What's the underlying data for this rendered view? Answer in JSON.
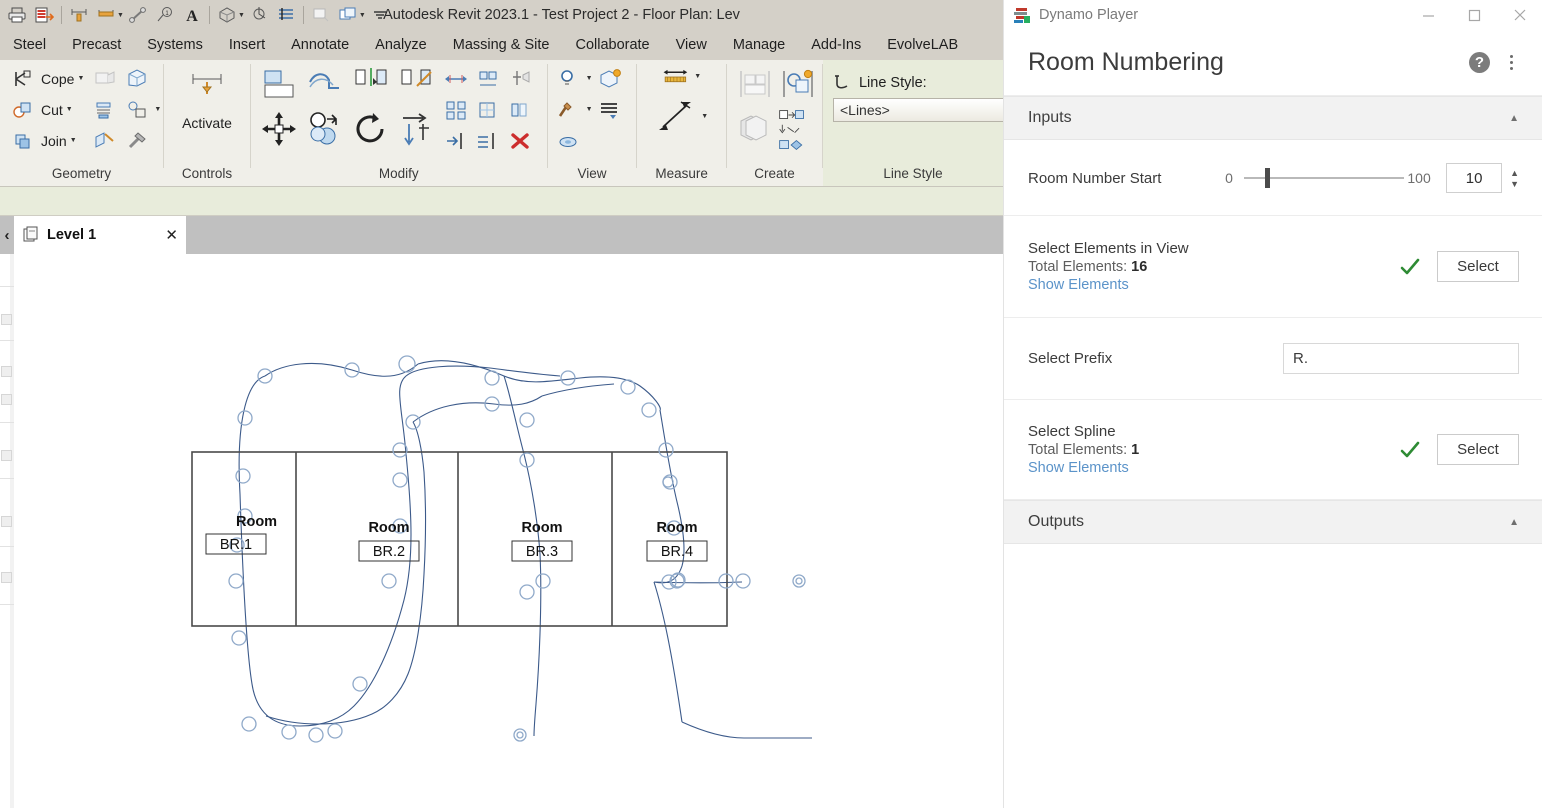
{
  "revit": {
    "title": "Autodesk Revit 2023.1 - Test Project 2 - Floor Plan: Lev",
    "quick_access": [
      {
        "name": "print-icon"
      },
      {
        "name": "export-icon"
      },
      {
        "name": "measure-icon"
      },
      {
        "name": "aligned-dimension-icon"
      },
      {
        "name": "tag-icon"
      },
      {
        "name": "keynote-icon"
      },
      {
        "name": "text-icon"
      },
      {
        "name": "default-3d-view-icon"
      },
      {
        "name": "section-icon"
      },
      {
        "name": "thin-lines-icon"
      },
      {
        "name": "close-hidden-windows-icon"
      },
      {
        "name": "switch-windows-icon"
      },
      {
        "name": "customize-qat-icon"
      }
    ],
    "ribbon_tabs": [
      "Steel",
      "Precast",
      "Systems",
      "Insert",
      "Annotate",
      "Analyze",
      "Massing & Site",
      "Collaborate",
      "View",
      "Manage",
      "Add-Ins",
      "EvolveLAB"
    ],
    "panels": [
      {
        "title": "Geometry",
        "buttons": [
          {
            "label": "Cope",
            "icon": "cope-icon",
            "dropdown": true
          },
          {
            "label": "Cut",
            "icon": "cut-icon",
            "dropdown": true
          },
          {
            "label": "Join",
            "icon": "join-icon",
            "dropdown": true
          },
          {
            "label": "",
            "icon": "demolish-icon",
            "dropdown": false
          },
          {
            "label": "",
            "icon": "split-face-icon",
            "dropdown": false
          },
          {
            "label": "",
            "icon": "beam-join-icon",
            "dropdown": false
          },
          {
            "label": "",
            "icon": "wall-joins-icon",
            "dropdown": true
          },
          {
            "label": "",
            "icon": "paint-icon",
            "dropdown": false
          },
          {
            "label": "",
            "icon": "hammer-icon",
            "dropdown": false
          }
        ]
      },
      {
        "title": "Controls",
        "buttons": [
          {
            "label": "Activate",
            "icon": "activate-dimensions-icon",
            "dropdown": false
          }
        ]
      },
      {
        "title": "Modify",
        "buttons": [
          {
            "label": "",
            "icon": "align-icon",
            "dropdown": false
          },
          {
            "label": "",
            "icon": "offset-icon",
            "dropdown": false
          },
          {
            "label": "",
            "icon": "mirror-pick-axis-icon",
            "dropdown": false
          },
          {
            "label": "",
            "icon": "mirror-draw-axis-icon",
            "dropdown": false
          },
          {
            "label": "",
            "icon": "move-icon",
            "dropdown": false
          },
          {
            "label": "",
            "icon": "copy-icon",
            "dropdown": false
          },
          {
            "label": "",
            "icon": "rotate-icon",
            "dropdown": false
          },
          {
            "label": "",
            "icon": "trim-extend-icon",
            "dropdown": false
          },
          {
            "label": "",
            "icon": "linear-array-icon",
            "dropdown": false
          },
          {
            "label": "",
            "icon": "radial-array-icon",
            "dropdown": false
          },
          {
            "label": "",
            "icon": "scale-icon",
            "dropdown": false
          },
          {
            "label": "",
            "icon": "resize-icon",
            "dropdown": false
          },
          {
            "label": "",
            "icon": "split-element-icon",
            "dropdown": false
          },
          {
            "label": "",
            "icon": "split-with-gap-icon",
            "dropdown": false
          },
          {
            "label": "",
            "icon": "pin-icon",
            "dropdown": false
          },
          {
            "label": "",
            "icon": "unpin-icon",
            "dropdown": false
          },
          {
            "label": "",
            "icon": "delete-icon",
            "dropdown": false
          }
        ]
      },
      {
        "title": "View",
        "buttons": [
          {
            "label": "",
            "icon": "reveal-hidden-elements-icon",
            "dropdown": true
          },
          {
            "label": "",
            "icon": "render-in-cloud-icon",
            "dropdown": false
          },
          {
            "label": "",
            "icon": "visibility-graphics-icon",
            "dropdown": true
          },
          {
            "label": "",
            "icon": "view-templates-icon",
            "dropdown": false
          },
          {
            "label": "",
            "icon": "hide-element-icon",
            "dropdown": false
          }
        ]
      },
      {
        "title": "Measure",
        "buttons": [
          {
            "label": "",
            "icon": "measure-between-references-icon",
            "dropdown": true
          },
          {
            "label": "",
            "icon": "measure-along-element-icon",
            "dropdown": true
          }
        ]
      },
      {
        "title": "Create",
        "buttons": [
          {
            "label": "",
            "icon": "create-similar-icon",
            "dropdown": false
          },
          {
            "label": "",
            "icon": "create-group-icon",
            "dropdown": false
          },
          {
            "label": "",
            "icon": "create-part-icon",
            "dropdown": false
          },
          {
            "label": "",
            "icon": "create-assembly-icon",
            "dropdown": false
          }
        ]
      }
    ],
    "line_style": {
      "panel_title": "Line Style",
      "label": "Line Style:",
      "value": "<Lines>"
    },
    "view_tab": {
      "label": "Level 1",
      "icon": "floor-plan-icon",
      "close": "✕"
    },
    "canvas": {
      "rooms": [
        {
          "label": "Room",
          "number": "BR.1"
        },
        {
          "label": "Room",
          "number": "BR.2"
        },
        {
          "label": "Room",
          "number": "BR.3"
        },
        {
          "label": "Room",
          "number": "BR.4"
        }
      ],
      "spline_color": "#3c5a8a",
      "node_color": "#8fa9c9",
      "wall_color": "#4a4a4a"
    }
  },
  "dynamo": {
    "window_title": "Dynamo Player",
    "window_controls": {
      "minimize": "—",
      "maximize": "□",
      "close": "✕"
    },
    "script_name": "Room Numbering",
    "help_icon": "?",
    "more_icon": "kebab-menu-icon",
    "inputs": {
      "section_label": "Inputs",
      "collapsed": false,
      "rows": [
        {
          "type": "slider",
          "label": "Room Number Start",
          "min": "0",
          "max": "100",
          "value": "10",
          "fill_percent": 13
        },
        {
          "type": "selection",
          "label": "Select Elements in View",
          "count_label": "Total Elements:",
          "count": "16",
          "link": "Show Elements",
          "status": "valid",
          "button": "Select"
        },
        {
          "type": "text",
          "label": "Select Prefix",
          "value": "R."
        },
        {
          "type": "selection",
          "label": "Select Spline",
          "count_label": "Total Elements:",
          "count": "1",
          "link": "Show Elements",
          "status": "valid",
          "button": "Select"
        }
      ]
    },
    "outputs": {
      "section_label": "Outputs",
      "collapsed": false,
      "items": []
    },
    "colors": {
      "accent_link": "#5b93c9",
      "check_green": "#2e8b34",
      "section_bg": "#f2f2f2"
    }
  }
}
